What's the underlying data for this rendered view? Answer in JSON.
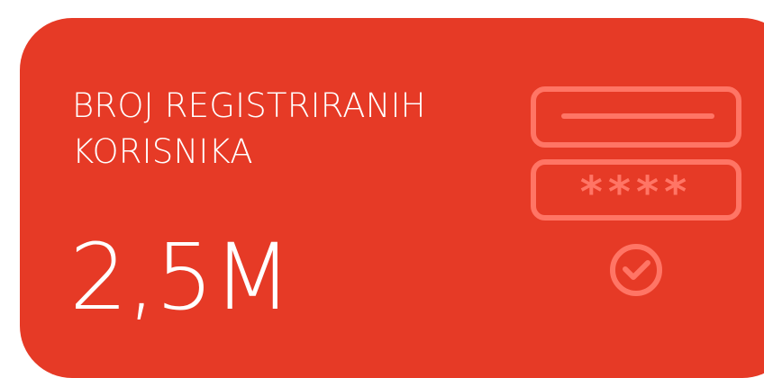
{
  "card": {
    "title": "BROJ REGISTRIRANIH KORISNIKA",
    "value": "2,5M",
    "background_color": "#e63a26",
    "text_color": "#ffffff",
    "icon_color": "#ff7565"
  },
  "illustration": {
    "icons": [
      "username-field-icon",
      "password-field-icon",
      "check-circle-icon"
    ],
    "password_mask": "****"
  }
}
